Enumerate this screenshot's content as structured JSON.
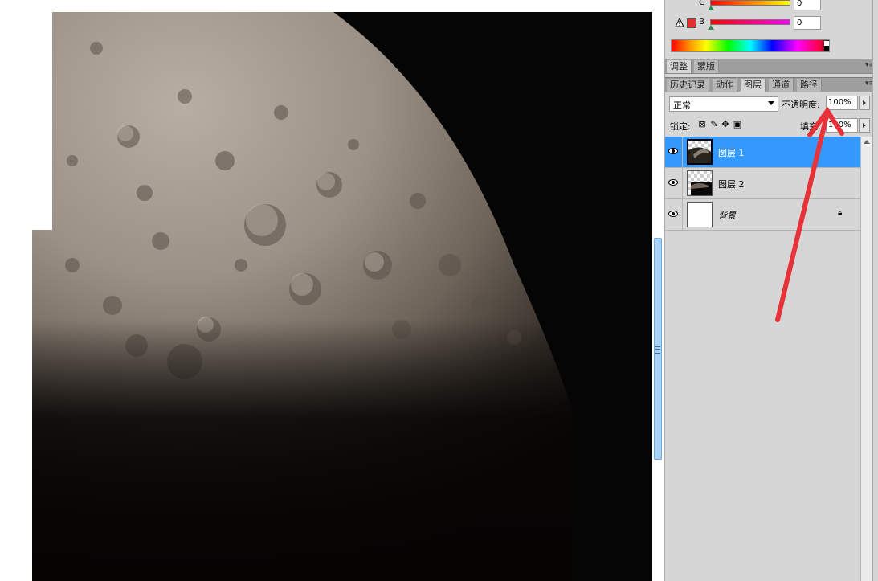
{
  "color_panel": {
    "channels": [
      {
        "letter": "G",
        "value": "0"
      },
      {
        "letter": "B",
        "value": "0"
      }
    ],
    "warning_icon": "warning-triangle-icon"
  },
  "adjust_tabs": [
    {
      "label": "调整"
    },
    {
      "label": "蒙版"
    }
  ],
  "layer_tabs": [
    {
      "label": "历史记录"
    },
    {
      "label": "动作"
    },
    {
      "label": "图层"
    },
    {
      "label": "通道"
    },
    {
      "label": "路径"
    }
  ],
  "blend": {
    "mode": "正常"
  },
  "opacity": {
    "label": "不透明度:",
    "value": "100%"
  },
  "lock": {
    "label": "锁定:"
  },
  "fill": {
    "label": "填充:",
    "value": "100%"
  },
  "layers": [
    {
      "name": "图层 1",
      "selected": true
    },
    {
      "name": "图层 2",
      "selected": false
    },
    {
      "name": "背景",
      "selected": false,
      "locked": true
    }
  ],
  "annotation": {
    "color": "#e8323a"
  }
}
